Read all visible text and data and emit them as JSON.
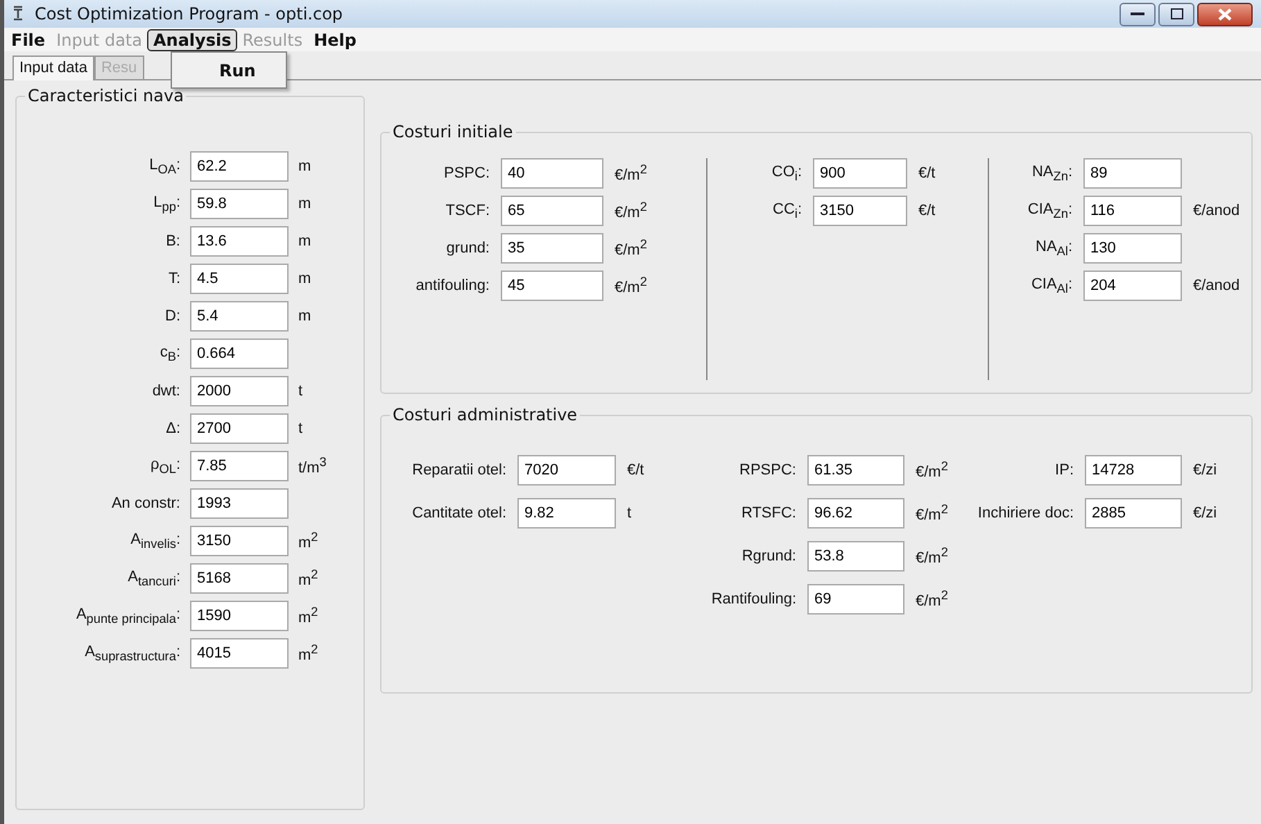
{
  "window": {
    "title": "Cost Optimization Program - opti.cop"
  },
  "menu": [
    {
      "label": "File",
      "disabled": false,
      "selected": false
    },
    {
      "label": "Input data",
      "disabled": true,
      "selected": false
    },
    {
      "label": "Analysis",
      "disabled": false,
      "selected": true
    },
    {
      "label": "Results",
      "disabled": true,
      "selected": false
    },
    {
      "label": "Help",
      "disabled": false,
      "selected": false
    }
  ],
  "dropdown": {
    "items": [
      {
        "label": "Run"
      }
    ]
  },
  "tabs": [
    {
      "label": "Input data",
      "selected": true
    },
    {
      "label": "Resu",
      "selected": false
    }
  ],
  "ship": {
    "title": "Caracteristici nava",
    "fields": [
      {
        "label": "L$_{OA}$:",
        "value": "62.2",
        "unit": "m"
      },
      {
        "label": "L$_{pp}$:",
        "value": "59.8",
        "unit": "m"
      },
      {
        "label": "B:",
        "value": "13.6",
        "unit": "m"
      },
      {
        "label": "T:",
        "value": "4.5",
        "unit": "m"
      },
      {
        "label": "D:",
        "value": "5.4",
        "unit": "m"
      },
      {
        "label": "c$_{B}$:",
        "value": "0.664"
      },
      {
        "label": "dwt:",
        "value": "2000",
        "unit": "t"
      },
      {
        "label": "Δ:",
        "value": "2700",
        "unit": "t"
      },
      {
        "label": "ρ$_{OL}$:",
        "value": "7.85",
        "unit": "t/m$^{3}$"
      },
      {
        "label": "An constr:",
        "value": "1993"
      },
      {
        "label": "A$_{invelis}$:",
        "value": "3150",
        "unit": "m$^{2}$"
      },
      {
        "label": "A$_{tancuri}$:",
        "value": "5168",
        "unit": "m$^{2}$"
      },
      {
        "label": "A$_{punte principala}$:",
        "value": "1590",
        "unit": "m$^{2}$"
      },
      {
        "label": "A$_{suprastructura}$:",
        "value": "4015",
        "unit": "m$^{2}$"
      }
    ]
  },
  "initial_costs": {
    "title": "Costuri initiale",
    "columns": [
      [
        {
          "label": "PSPC:",
          "value": "40",
          "unit": "€/m$^{2}$"
        },
        {
          "label": "TSCF:",
          "value": "65",
          "unit": "€/m$^{2}$"
        },
        {
          "label": "grund:",
          "value": "35",
          "unit": "€/m$^{2}$"
        },
        {
          "label": "antifouling:",
          "value": "45",
          "unit": "€/m$^{2}$"
        }
      ],
      [
        {
          "label": "CO$_{i}$:",
          "value": "900",
          "unit": "€/t"
        },
        {
          "label": "CC$_{i}$:",
          "value": "3150",
          "unit": "€/t"
        }
      ],
      [
        {
          "label": "NA$_{Zn}$:",
          "value": "89"
        },
        {
          "label": "CIA$_{Zn}$:",
          "value": "116",
          "unit": "€/anod"
        },
        {
          "label": "NA$_{Al}$:",
          "value": "130"
        },
        {
          "label": "CIA$_{Al}$:",
          "value": "204",
          "unit": "€/anod"
        }
      ]
    ]
  },
  "admin_costs": {
    "title": "Costuri administrative",
    "columns": [
      [
        {
          "label": "Reparatii otel:",
          "value": "7020",
          "unit": "€/t"
        },
        {
          "label": "Cantitate otel:",
          "value": "9.82",
          "unit": "t"
        }
      ],
      [
        {
          "label": "RPSPC:",
          "value": "61.35",
          "unit": "€/m$^{2}$"
        },
        {
          "label": "RTSFC:",
          "value": "96.62",
          "unit": "€/m$^{2}$"
        },
        {
          "label": "Rgrund:",
          "value": "53.8",
          "unit": "€/m$^{2}$"
        },
        {
          "label": "Rantifouling:",
          "value": "69",
          "unit": "€/m$^{2}$"
        }
      ],
      [
        {
          "label": "IP:",
          "value": "14728",
          "unit": "€/zi"
        },
        {
          "label": "Inchiriere doc:",
          "value": "2885",
          "unit": "€/zi"
        }
      ]
    ]
  }
}
